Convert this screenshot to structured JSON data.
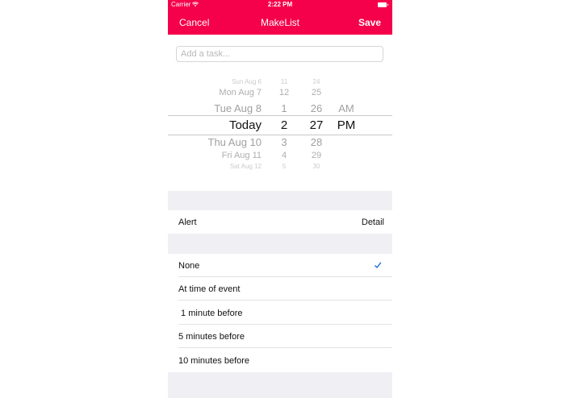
{
  "status": {
    "carrier": "Carrier",
    "time": "2:22 PM"
  },
  "nav": {
    "left": "Cancel",
    "title": "MakeList",
    "right": "Save"
  },
  "task": {
    "placeholder": "Add a task...",
    "value": ""
  },
  "picker": {
    "dates": [
      "Sun Aug 6",
      "Mon Aug 7",
      "Tue Aug 8",
      "Today",
      "Thu Aug 10",
      "Fri Aug 11",
      "Sat Aug 12"
    ],
    "hours": [
      "11",
      "12",
      "1",
      "2",
      "3",
      "4",
      "5"
    ],
    "minutes": [
      "24",
      "25",
      "26",
      "27",
      "28",
      "29",
      "30"
    ],
    "periods": [
      "AM",
      "PM"
    ],
    "selected": {
      "date": "Today",
      "hour": "2",
      "minute": "27",
      "period": "PM"
    }
  },
  "alert": {
    "label": "Alert",
    "detail": "Detail"
  },
  "options": [
    "None",
    "At time of event",
    " 1 minute before",
    "5 minutes before",
    "10 minutes before"
  ],
  "selected_option": "None",
  "colors": {
    "accent": "#f5004a",
    "check": "#1a6fd6",
    "group_bg": "#efeff4"
  }
}
